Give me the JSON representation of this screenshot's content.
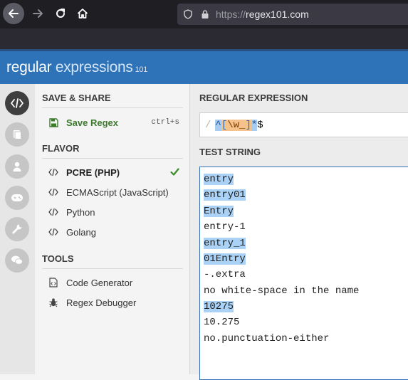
{
  "browser": {
    "url_protocol": "https://",
    "url_host": "regex101.com"
  },
  "site": {
    "logo_regular": "regular",
    "logo_expressions": " expressions",
    "logo_version": "101"
  },
  "rail": {
    "icons": [
      "code-icon",
      "library-icon",
      "user-icon",
      "gamepad-icon",
      "wrench-icon",
      "chat-icon"
    ]
  },
  "sidebar": {
    "save_share_title": "SAVE & SHARE",
    "save_regex_label": "Save Regex",
    "save_regex_shortcut": "ctrl+s",
    "flavor_title": "FLAVOR",
    "flavors": [
      {
        "label": "PCRE (PHP)",
        "selected": true
      },
      {
        "label": "ECMAScript (JavaScript)",
        "selected": false
      },
      {
        "label": "Python",
        "selected": false
      },
      {
        "label": "Golang",
        "selected": false
      }
    ],
    "tools_title": "TOOLS",
    "tools": [
      {
        "label": "Code Generator",
        "icon": "code-file-icon"
      },
      {
        "label": "Regex Debugger",
        "icon": "bug-icon"
      }
    ]
  },
  "main": {
    "regex_title": "REGULAR EXPRESSION",
    "regex_delimiter": "/",
    "regex_tokens": {
      "anchor_start": "^",
      "class_open": "[",
      "class_body": "\\w_",
      "class_close": "]",
      "quantifier": "*",
      "anchor_end": "$"
    },
    "test_title": "TEST STRING",
    "test_lines": [
      {
        "text": "entry",
        "match": true
      },
      {
        "text": "entry01",
        "match": true
      },
      {
        "text": "Entry",
        "match": true
      },
      {
        "text": "entry-1",
        "match": false
      },
      {
        "text": "entry_1",
        "match": true
      },
      {
        "text": "01Entry",
        "match": true
      },
      {
        "text": "-.extra",
        "match": false
      },
      {
        "text": "no white-space in the name",
        "match": false
      },
      {
        "text": "10275",
        "match": true
      },
      {
        "text": "10.275",
        "match": false
      },
      {
        "text": "no.punctuation-either",
        "match": false
      }
    ]
  },
  "colors": {
    "header_blue": "#2e72b8",
    "match_highlight": "#a9d2f6",
    "save_green": "#3c7a2c",
    "check_green": "#3c8a2c"
  }
}
